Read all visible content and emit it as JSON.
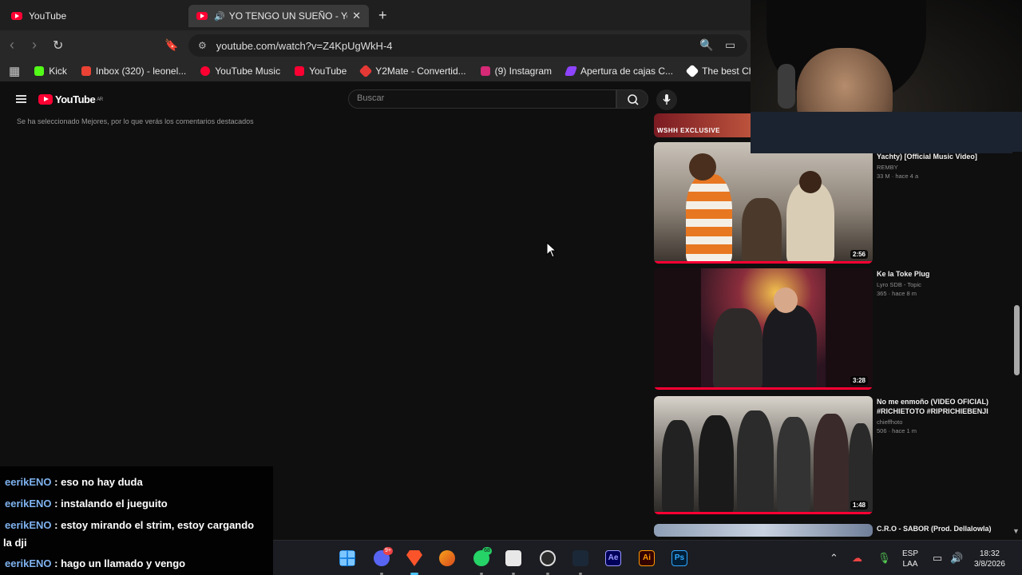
{
  "browser": {
    "tabs": [
      {
        "title": "YouTube",
        "active": false
      },
      {
        "title": "YO TENGO UN SUEÑO - YouT",
        "active": true
      }
    ],
    "url": "youtube.com/watch?v=Z4KpUgWkH-4",
    "bookmarks": [
      {
        "label": "Kick",
        "color": "#53fc18"
      },
      {
        "label": "Inbox (320) - leonel...",
        "color": "#ea4335"
      },
      {
        "label": "YouTube Music",
        "color": "#ff0033"
      },
      {
        "label": "YouTube",
        "color": "#ff0033"
      },
      {
        "label": "Y2Mate - Convertid...",
        "color": "#e53935"
      },
      {
        "label": "(9) Instagram",
        "color": "#d62976"
      },
      {
        "label": "Apertura de cajas C...",
        "color": "#8e44ff"
      },
      {
        "label": "The best ChatBo",
        "color": "#ffffff"
      }
    ]
  },
  "youtube": {
    "logo": "YouTube",
    "country": "AR",
    "search_placeholder": "Buscar",
    "notice": "Se ha seleccionado Mejores, por lo que verás los comentarios destacados",
    "top_thumb_badge": "WSHH EXCLUSIVE",
    "recommendations": [
      {
        "title": "Yachty) [Official Music Video]",
        "channel": "REMBY",
        "stats": "33 M · hace 4 a",
        "duration": "2:56"
      },
      {
        "title": "Ke la Toke Plug",
        "channel": "Lyro SDB - Topic",
        "stats": "365 · hace 8 m",
        "duration": "3:28"
      },
      {
        "title": "No me enmoño (VIDEO OFICIAL) #RICHIETOTO #RIPRICHIEBENJI",
        "channel": "chieffhoto",
        "stats": "506 · hace 1 m",
        "duration": "1:48"
      },
      {
        "title": "C.R.O - SABOR (Prod. Dellalowla)",
        "channel": "",
        "stats": "",
        "duration": ""
      }
    ]
  },
  "chat": {
    "messages": [
      {
        "user": "eerikENO",
        "text": " : eso no hay duda"
      },
      {
        "user": "eerikENO",
        "text": " : instalando el jueguito"
      },
      {
        "user": "eerikENO",
        "text": " : estoy mirando el strim, estoy cargando"
      },
      {
        "user": "",
        "text": "la dji"
      },
      {
        "user": "eerikENO",
        "text": " : hago un llamado y vengo"
      }
    ]
  },
  "taskbar": {
    "discord_badge": "9+",
    "whatsapp_badge": "68",
    "language": "ESP",
    "layout": "LAA",
    "time": "18:32",
    "date": "3/8/2026"
  },
  "colors": {
    "youtube_red": "#ff0033",
    "chat_username": "#7fb3f0",
    "taskbar_bg": "#1c1d22"
  }
}
